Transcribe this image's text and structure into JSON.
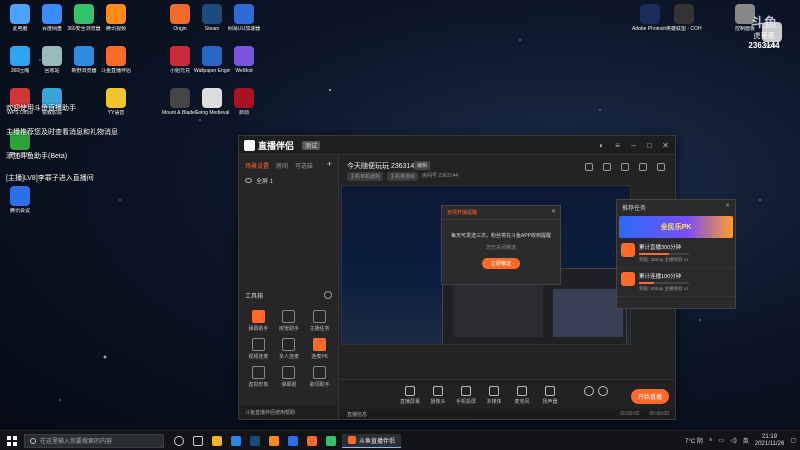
{
  "desktop": {
    "icons": [
      {
        "label": "此电脑",
        "color": "#4aa3ff"
      },
      {
        "label": "百度网盘",
        "color": "#3a8dff"
      },
      {
        "label": "360安全浏览器",
        "color": "#34c26b"
      },
      {
        "label": "腾讯视频",
        "color": "#ff8a1a"
      },
      {
        "label": "Origin",
        "color": "#f46a28"
      },
      {
        "label": "Steam",
        "color": "#1b4b7a"
      },
      {
        "label": "网易UU加速器",
        "color": "#2d6ad6"
      },
      {
        "label": "360压缩",
        "color": "#2fa3f3"
      },
      {
        "label": "回收站",
        "color": "#9bb"
      },
      {
        "label": "新野浏览器",
        "color": "#2e8be0"
      },
      {
        "label": "斗鱼直播伴侣",
        "color": "#ff6a2b"
      },
      {
        "label": "小姐元兑",
        "color": "#cc2b3a"
      },
      {
        "label": "Wallpaper Engine:...",
        "color": "#2a64c4"
      },
      {
        "label": "WeMod",
        "color": "#7a53e0"
      },
      {
        "label": "WPS Office",
        "color": "#d13636"
      },
      {
        "label": "极致影院",
        "color": "#3aa3d8"
      },
      {
        "label": "YY语音",
        "color": "#f2c52a"
      },
      {
        "label": "Mount & Blade II ...",
        "color": "#444"
      },
      {
        "label": "Going Medieval",
        "color": "#ddd"
      },
      {
        "label": "启动",
        "color": "#a12"
      },
      {
        "label": "腾讯游戏",
        "color": "#2ba33a"
      },
      {
        "label": "Adobe Photosh...",
        "color": "#1a2c5a"
      },
      {
        "label": "英雄联盟 - COH...",
        "color": "#333"
      },
      {
        "label": "控制面板",
        "color": "#888"
      },
      {
        "label": "2020...",
        "color": "#ccc"
      },
      {
        "label": "腾讯会议",
        "color": "#2b6ee8"
      }
    ],
    "notices": [
      "欢迎使用斗鱼直播助手",
      "主播推荐您及时查看消息和礼物消息",
      "添加斗鱼助手(Beta)",
      "[主播]LV8]李罪子进入直播间"
    ],
    "corner_badge": {
      "title": "斗鱼",
      "sub": "虎哥哥",
      "room_no": "2363144"
    }
  },
  "app": {
    "title": "直播伴侣",
    "version_badge": "测试",
    "left": {
      "tabs": [
        "场景设置",
        "房间",
        "可选装"
      ],
      "active_tab": 0,
      "scene_label": "全屏 1",
      "tools_header": "工具箱",
      "tools": [
        {
          "label": "弹幕助手",
          "hot": true
        },
        {
          "label": "房管助手",
          "hot": false
        },
        {
          "label": "主播任务",
          "hot": false
        },
        {
          "label": "视频连麦",
          "hot": false
        },
        {
          "label": "多人连麦",
          "hot": false
        },
        {
          "label": "连麦PK",
          "hot": true
        },
        {
          "label": "虚拟形象",
          "hot": false
        },
        {
          "label": "弹幕姬",
          "hot": false
        },
        {
          "label": "歌词助手",
          "hot": false
        }
      ],
      "footer": "斗鱼直播伴侣使用帮助"
    },
    "room": {
      "title": "今天随便玩玩 2363144",
      "tag": "编辑",
      "sub_pills": [
        "主机单机游戏",
        "主机类游戏"
      ],
      "sub_room": "房间号 2363144"
    },
    "dialog": {
      "header": "友情开播提醒",
      "text": "每天可发送三次，粉丝将在斗鱼APP收到提醒",
      "sub": "您已关闭推送",
      "button": "立即推送"
    },
    "recommend": {
      "header": "推荐任务",
      "banner": "全民乐PK",
      "tasks": [
        {
          "title": "累计直播300分钟",
          "reward": "奖励: 30Exp 主播经验 x1",
          "progress": 0.6
        },
        {
          "title": "累计连播100分钟",
          "reward": "奖励: 50Exp 主播经验 x1",
          "progress": 0.3
        }
      ]
    },
    "controls": [
      {
        "label": "直播屏幕",
        "icon": "screen-icon"
      },
      {
        "label": "摄像头",
        "icon": "camera-icon"
      },
      {
        "label": "手机投屏",
        "icon": "phone-cast-icon"
      },
      {
        "label": "多媒体",
        "icon": "media-icon"
      },
      {
        "label": "麦克风",
        "icon": "mic-icon"
      },
      {
        "label": "扬声器",
        "icon": "speaker-icon"
      }
    ],
    "start_button": "开始直播",
    "status": {
      "live_label": "直播信息",
      "time1": "00:00:02",
      "time2": "00:00:00"
    }
  },
  "taskbar": {
    "search_placeholder": "在这里输入你要搜索的内容",
    "active_app": "斗鱼直播伴侣",
    "weather": "7°C 阴",
    "ime": "英",
    "time": "21:19",
    "date": "2021/11/26"
  }
}
